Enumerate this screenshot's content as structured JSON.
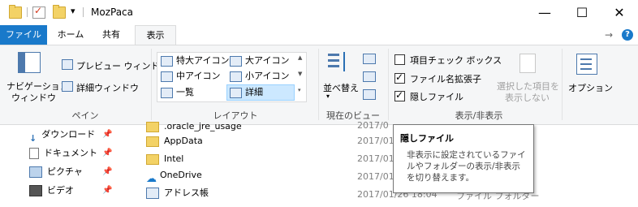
{
  "window": {
    "title": "MozPaca",
    "minimize_glyph": "—",
    "maximize_glyph": "☐",
    "close_glyph": "✕",
    "dropdown_glyph": "▾"
  },
  "tabs": {
    "file": "ファイル",
    "home": "ホーム",
    "share": "共有",
    "view": "表示",
    "pin_glyph": "→",
    "help_glyph": "?"
  },
  "ribbon": {
    "pane": {
      "nav_pane_line1": "ナビゲーション",
      "nav_pane_line2": "ウィンドウ",
      "preview_pane": "プレビュー ウィンドウ",
      "details_pane": "詳細ウィンドウ",
      "label": "ペイン"
    },
    "layout": {
      "extra_large": "特大アイコン",
      "large": "大アイコン",
      "medium": "中アイコン",
      "small": "小アイコン",
      "list": "一覧",
      "details": "詳細",
      "label": "レイアウト"
    },
    "current_view": {
      "sort_by_line1": "並べ替え",
      "label": "現在のビュー"
    },
    "show_hide": {
      "item_checkboxes": "項目チェック ボックス",
      "file_extensions": "ファイル名拡張子",
      "hidden_items": "隠しファイル",
      "hide_selected_line1": "選択した項目を",
      "hide_selected_line2": "表示しない",
      "label": "表示/非表示",
      "item_checkboxes_checked": false,
      "file_extensions_checked": true,
      "hidden_items_checked": true
    },
    "options": {
      "label": "オプション"
    }
  },
  "nav": {
    "items": [
      {
        "label": "ダウンロード"
      },
      {
        "label": "ドキュメント"
      },
      {
        "label": "ピクチャ"
      },
      {
        "label": "ビデオ"
      }
    ]
  },
  "files": {
    "rows": [
      {
        "name": ".oracle_jre_usage",
        "date": "2017/0"
      },
      {
        "name": "AppData",
        "date": "2017/01"
      },
      {
        "name": "Intel",
        "date": "2017/01"
      },
      {
        "name": "OneDrive",
        "date": "2017/01"
      },
      {
        "name": "アドレス帳",
        "date": "2017/01/26 18:04",
        "type": "ファイル フォルダー"
      }
    ]
  },
  "tooltip": {
    "title": "隠しファイル",
    "body": "非表示に設定されているファイルやフォルダーの表示/非表示を切り替えます。"
  },
  "colors": {
    "accent": "#1979ca",
    "ribbon_bg": "#f5f6f7",
    "selection": "#cce8ff"
  }
}
